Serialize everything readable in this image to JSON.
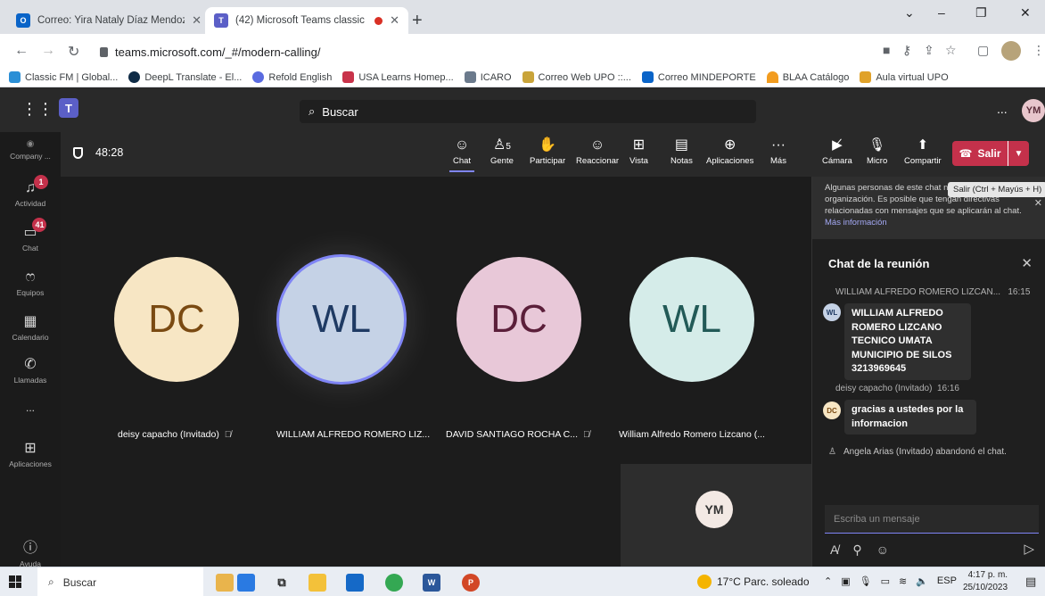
{
  "browser": {
    "tabs": [
      {
        "title": "Correo: Yira Nataly Díaz Mendoz",
        "close": "✕"
      },
      {
        "title": "(42) Microsoft Teams classic",
        "close": "✕"
      }
    ],
    "new_tab": "+",
    "window_controls": {
      "chevron": "⌄",
      "minimize": "–",
      "restore": "❐",
      "close": "✕"
    },
    "url": "teams.microsoft.com/_#/modern-calling/",
    "bookmarks": [
      "Classic FM | Global...",
      "DeepL Translate - El...",
      "Refold English",
      "USA Learns Homep...",
      "ICARO",
      "Correo Web UPO ::...",
      "Correo MINDEPORTE",
      "BLAA Catálogo",
      "Aula virtual UPO"
    ]
  },
  "teams": {
    "search_label": "Buscar",
    "more": "...",
    "user_initials": "YM",
    "rail": [
      {
        "label": "Company ...",
        "icon": "company-icon"
      },
      {
        "label": "Actividad",
        "badge": "1",
        "icon": "bell-icon"
      },
      {
        "label": "Chat",
        "badge": "41",
        "icon": "chat-icon"
      },
      {
        "label": "Equipos",
        "icon": "teams-icon"
      },
      {
        "label": "Calendario",
        "icon": "calendar-icon"
      },
      {
        "label": "Llamadas",
        "icon": "phone-icon"
      },
      {
        "label": "...",
        "icon": "more-icon"
      },
      {
        "label": "Aplicaciones",
        "icon": "apps-icon"
      },
      {
        "label": "Ayuda",
        "icon": "help-icon"
      }
    ]
  },
  "meeting": {
    "timer": "48:28",
    "tools": {
      "chat": "Chat",
      "people_count": "5",
      "people": "Gente",
      "raise": "Participar",
      "react": "Reaccionar",
      "view": "Vista",
      "notes": "Notas",
      "apps": "Aplicaciones",
      "more": "Más",
      "camera": "Cámara",
      "mic": "Micro",
      "share": "Compartir",
      "leave": "Salir"
    },
    "participants": [
      {
        "initials": "DC",
        "name": "deisy capacho (Invitado)",
        "muted": true,
        "bg": "#f7e6c4",
        "fg": "#7a4a12"
      },
      {
        "initials": "WL",
        "name": "WILLIAM ALFREDO ROMERO LIZ...",
        "muted": false,
        "bg": "#c5d2e6",
        "fg": "#1f3a63"
      },
      {
        "initials": "DC",
        "name": "DAVID SANTIAGO ROCHA C...",
        "muted": true,
        "bg": "#e8c8d8",
        "fg": "#5b1f3a"
      },
      {
        "initials": "WL",
        "name": "William Alfredo Romero Lizcano (...",
        "muted": false,
        "bg": "#d5ece9",
        "fg": "#225a57"
      }
    ],
    "self_initials": "YM"
  },
  "chat": {
    "notice": "Algunas personas de este chat no están en su organización. Es posible que tengan directivas relacionadas con mensajes que se aplicarán al chat.",
    "notice_link": "Más información",
    "leave_tooltip": "Salir (Ctrl + Mayús + H)",
    "title": "Chat de la reunión",
    "messages": [
      {
        "sender": "WILLIAM ALFREDO ROMERO LIZCAN...",
        "time": "16:15",
        "avatar": "WL",
        "text": "WILLIAM ALFREDO ROMERO LIZCANO TECNICO UMATA MUNICIPIO DE SILOS 3213969645"
      },
      {
        "sender": "deisy capacho (Invitado)",
        "time": "16:16",
        "avatar": "DC",
        "text": "gracias a ustedes por la informacion"
      }
    ],
    "system_message": "Angela Arias (Invitado) abandonó el chat.",
    "compose_placeholder": "Escriba un mensaje"
  },
  "taskbar": {
    "search": "Buscar",
    "weather": "17°C  Parc. soleado",
    "lang": "ESP",
    "time": "4:17 p. m.",
    "date": "25/10/2023"
  },
  "colors": {
    "accent": "#7f85f5",
    "leave": "#c4314b",
    "teams": "#5b5fc7"
  }
}
